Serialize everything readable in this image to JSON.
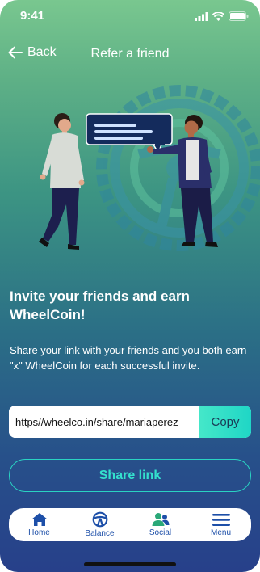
{
  "status_bar": {
    "time": "9:41"
  },
  "nav": {
    "back_label": "Back",
    "title": "Refer a friend"
  },
  "content": {
    "headline": "Invite your friends and earn WheelCoin!",
    "description": "Share your link with your friends and you both earn \"x\" WheelCoin for each successful invite."
  },
  "referral": {
    "link": "https//wheelco.in/share/mariaperez",
    "copy_label": "Copy"
  },
  "share_label": "Share link",
  "tabs": [
    {
      "label": "Home",
      "icon": "home-icon"
    },
    {
      "label": "Balance",
      "icon": "steering-wheel-icon"
    },
    {
      "label": "Social",
      "icon": "people-icon"
    },
    {
      "label": "Menu",
      "icon": "hamburger-menu-icon"
    }
  ],
  "colors": {
    "accent": "#2ad3c2",
    "copy_button": "#45e7c9",
    "tab_icon": "#1d4fa8",
    "social_icon": "#2aa878"
  }
}
